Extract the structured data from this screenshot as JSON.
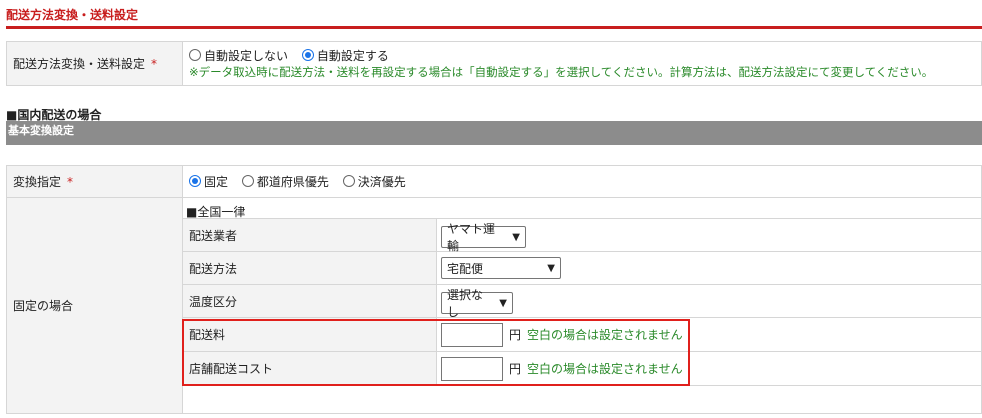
{
  "page": {
    "title": "配送方法変換・送料設定"
  },
  "auto_setting": {
    "label": "配送方法変換・送料設定",
    "required_mark": "*",
    "options": [
      {
        "label": "自動設定しない",
        "checked": false
      },
      {
        "label": "自動設定する",
        "checked": true
      }
    ],
    "note": "※データ取込時に配送方法・送料を再設定する場合は「自動設定する」を選択してください。計算方法は、配送方法設定にて変更してください。"
  },
  "domestic": {
    "heading": "■国内配送の場合",
    "section_bar": "基本変換設定"
  },
  "conversion": {
    "label": "変換指定",
    "required_mark": "*",
    "options": [
      {
        "label": "固定",
        "checked": true
      },
      {
        "label": "都道府県優先",
        "checked": false
      },
      {
        "label": "決済優先",
        "checked": false
      }
    ]
  },
  "fixed": {
    "label": "固定の場合",
    "sub_title": "■全国一律",
    "carrier": {
      "label": "配送業者",
      "value": "ヤマト運輸"
    },
    "method": {
      "label": "配送方法",
      "value": "宅配便"
    },
    "temperature": {
      "label": "温度区分",
      "value": "選択なし"
    },
    "shipping_fee": {
      "label": "配送料",
      "value": "",
      "unit": "円",
      "note": "空白の場合は設定されません"
    },
    "store_cost": {
      "label": "店舗配送コスト",
      "value": "",
      "unit": "円",
      "note": "空白の場合は設定されません"
    }
  },
  "colors": {
    "accent": "#c81e1e",
    "note_green": "#2a8a2a",
    "highlight": "#e0201c",
    "radio_blue": "#1a73e8"
  }
}
